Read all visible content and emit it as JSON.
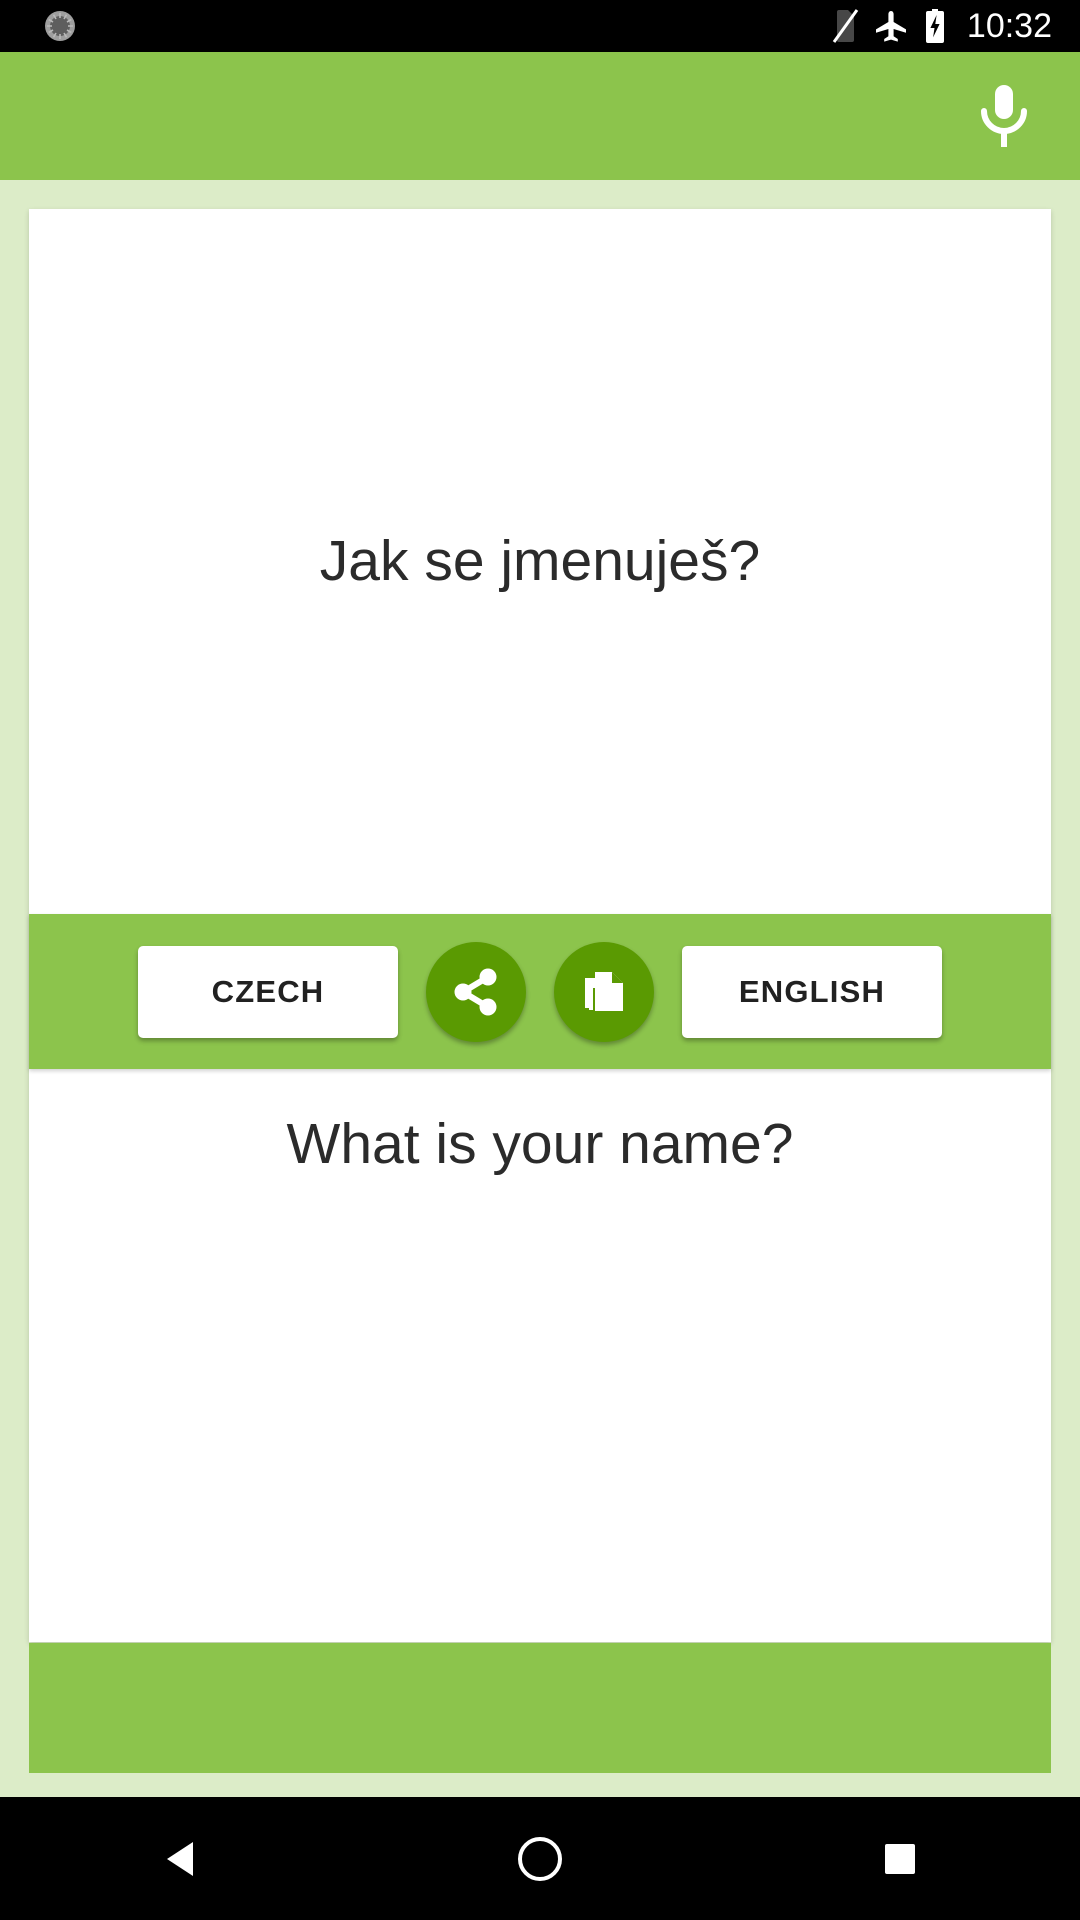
{
  "status_bar": {
    "time": "10:32",
    "icons": [
      "sync-icon",
      "no-sim-icon",
      "airplane-mode-icon",
      "battery-charging-icon"
    ],
    "background_color": "#000000",
    "foreground_color": "#ffffff"
  },
  "app_bar": {
    "background_color": "#8cc44c",
    "mic_icon": "microphone-icon",
    "mic_label": "Speak"
  },
  "translation": {
    "source": {
      "text": "Jak se jmenuješ?",
      "language_label": "CZECH"
    },
    "target": {
      "text": "What is your name?",
      "language_label": "ENGLISH"
    }
  },
  "toolbar": {
    "background_color": "#8cc44c",
    "button_color": "#5a9a02",
    "share_icon": "share-icon",
    "share_label": "Share",
    "copy_icon": "copy-icon",
    "copy_label": "Copy"
  },
  "nav_bar": {
    "back_icon": "back-triangle-icon",
    "home_icon": "home-circle-icon",
    "recents_icon": "recents-square-icon",
    "background_color": "#000000"
  },
  "theme": {
    "primary": "#8cc44c",
    "primary_dark": "#5a9a02",
    "background": "#dcecc8",
    "card": "#ffffff",
    "text": "#2b2b2b"
  }
}
